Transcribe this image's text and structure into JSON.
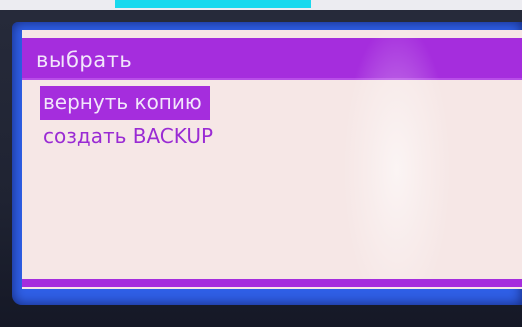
{
  "screen": {
    "title": "выбрать",
    "items": [
      {
        "label": "вернуть копию",
        "selected": true
      },
      {
        "label": "создать BACKUP",
        "selected": false
      }
    ]
  },
  "colors": {
    "accent": "#a52ddd",
    "screen_background": "#f6e7e6",
    "frame": "#2f5fe6",
    "label_tag": "#19d9ee"
  }
}
